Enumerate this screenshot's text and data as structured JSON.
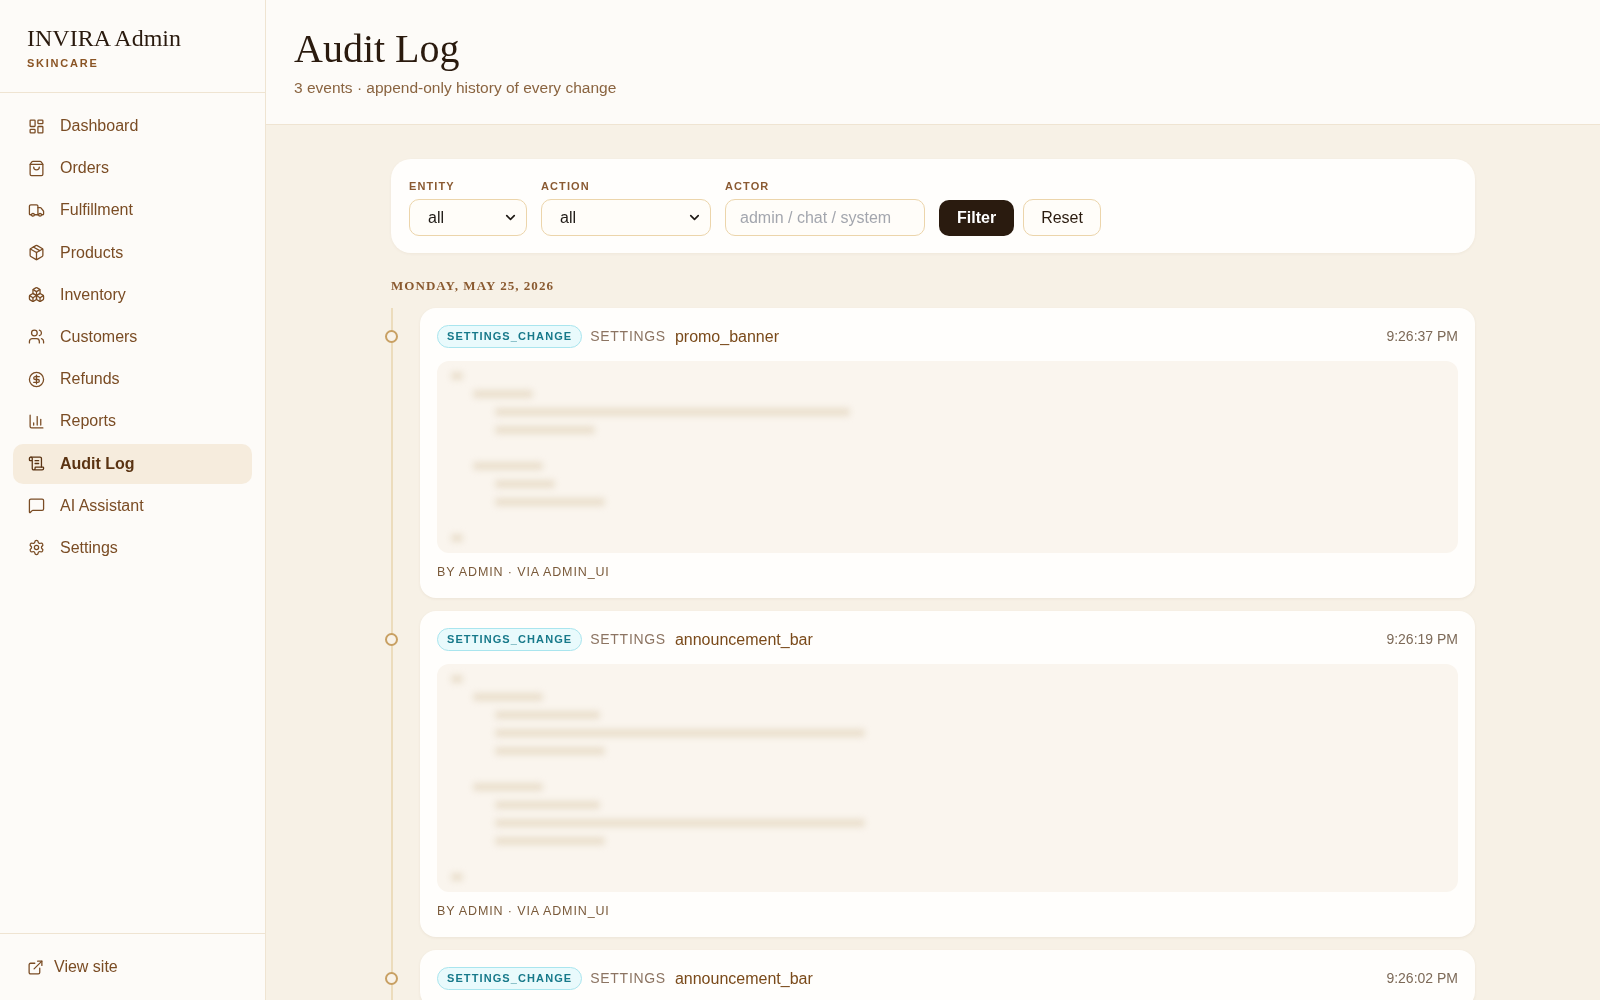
{
  "sidebar": {
    "brand": "INVIRA Admin",
    "tagline": "SKINCARE",
    "items": [
      {
        "label": "Dashboard",
        "selected": false
      },
      {
        "label": "Orders",
        "selected": false
      },
      {
        "label": "Fulfillment",
        "selected": false
      },
      {
        "label": "Products",
        "selected": false
      },
      {
        "label": "Inventory",
        "selected": false
      },
      {
        "label": "Customers",
        "selected": false
      },
      {
        "label": "Refunds",
        "selected": false
      },
      {
        "label": "Reports",
        "selected": false
      },
      {
        "label": "Audit Log",
        "selected": true
      },
      {
        "label": "AI Assistant",
        "selected": false
      },
      {
        "label": "Settings",
        "selected": false
      }
    ],
    "footer_link": "View site"
  },
  "header": {
    "title": "Audit Log",
    "subtitle": "3 events · append-only history of every change"
  },
  "filters": {
    "fields": [
      {
        "kind": "select",
        "label": "ENTITY",
        "value": "all"
      },
      {
        "kind": "select",
        "label": "ACTION",
        "value": "all"
      },
      {
        "kind": "text",
        "label": "ACTOR",
        "placeholder": "admin / chat / system"
      }
    ],
    "buttons": [
      {
        "kind": "primary",
        "label": "Filter"
      },
      {
        "kind": "secondary",
        "label": "Reset"
      }
    ]
  },
  "timeline": [
    {
      "date": "MONDAY, MAY 25, 2026",
      "events": [
        {
          "action": "SETTINGS_CHANGE",
          "entity": "SETTINGS",
          "key": "promo_banner",
          "time": "9:26:37 PM",
          "actor_line": "BY ADMIN · VIA ADMIN_UI"
        },
        {
          "action": "SETTINGS_CHANGE",
          "entity": "SETTINGS",
          "key": "announcement_bar",
          "time": "9:26:19 PM",
          "actor_line": "BY ADMIN · VIA ADMIN_UI"
        },
        {
          "action": "SETTINGS_CHANGE",
          "entity": "SETTINGS",
          "key": "announcement_bar",
          "time": "9:26:02 PM"
        }
      ]
    }
  ]
}
